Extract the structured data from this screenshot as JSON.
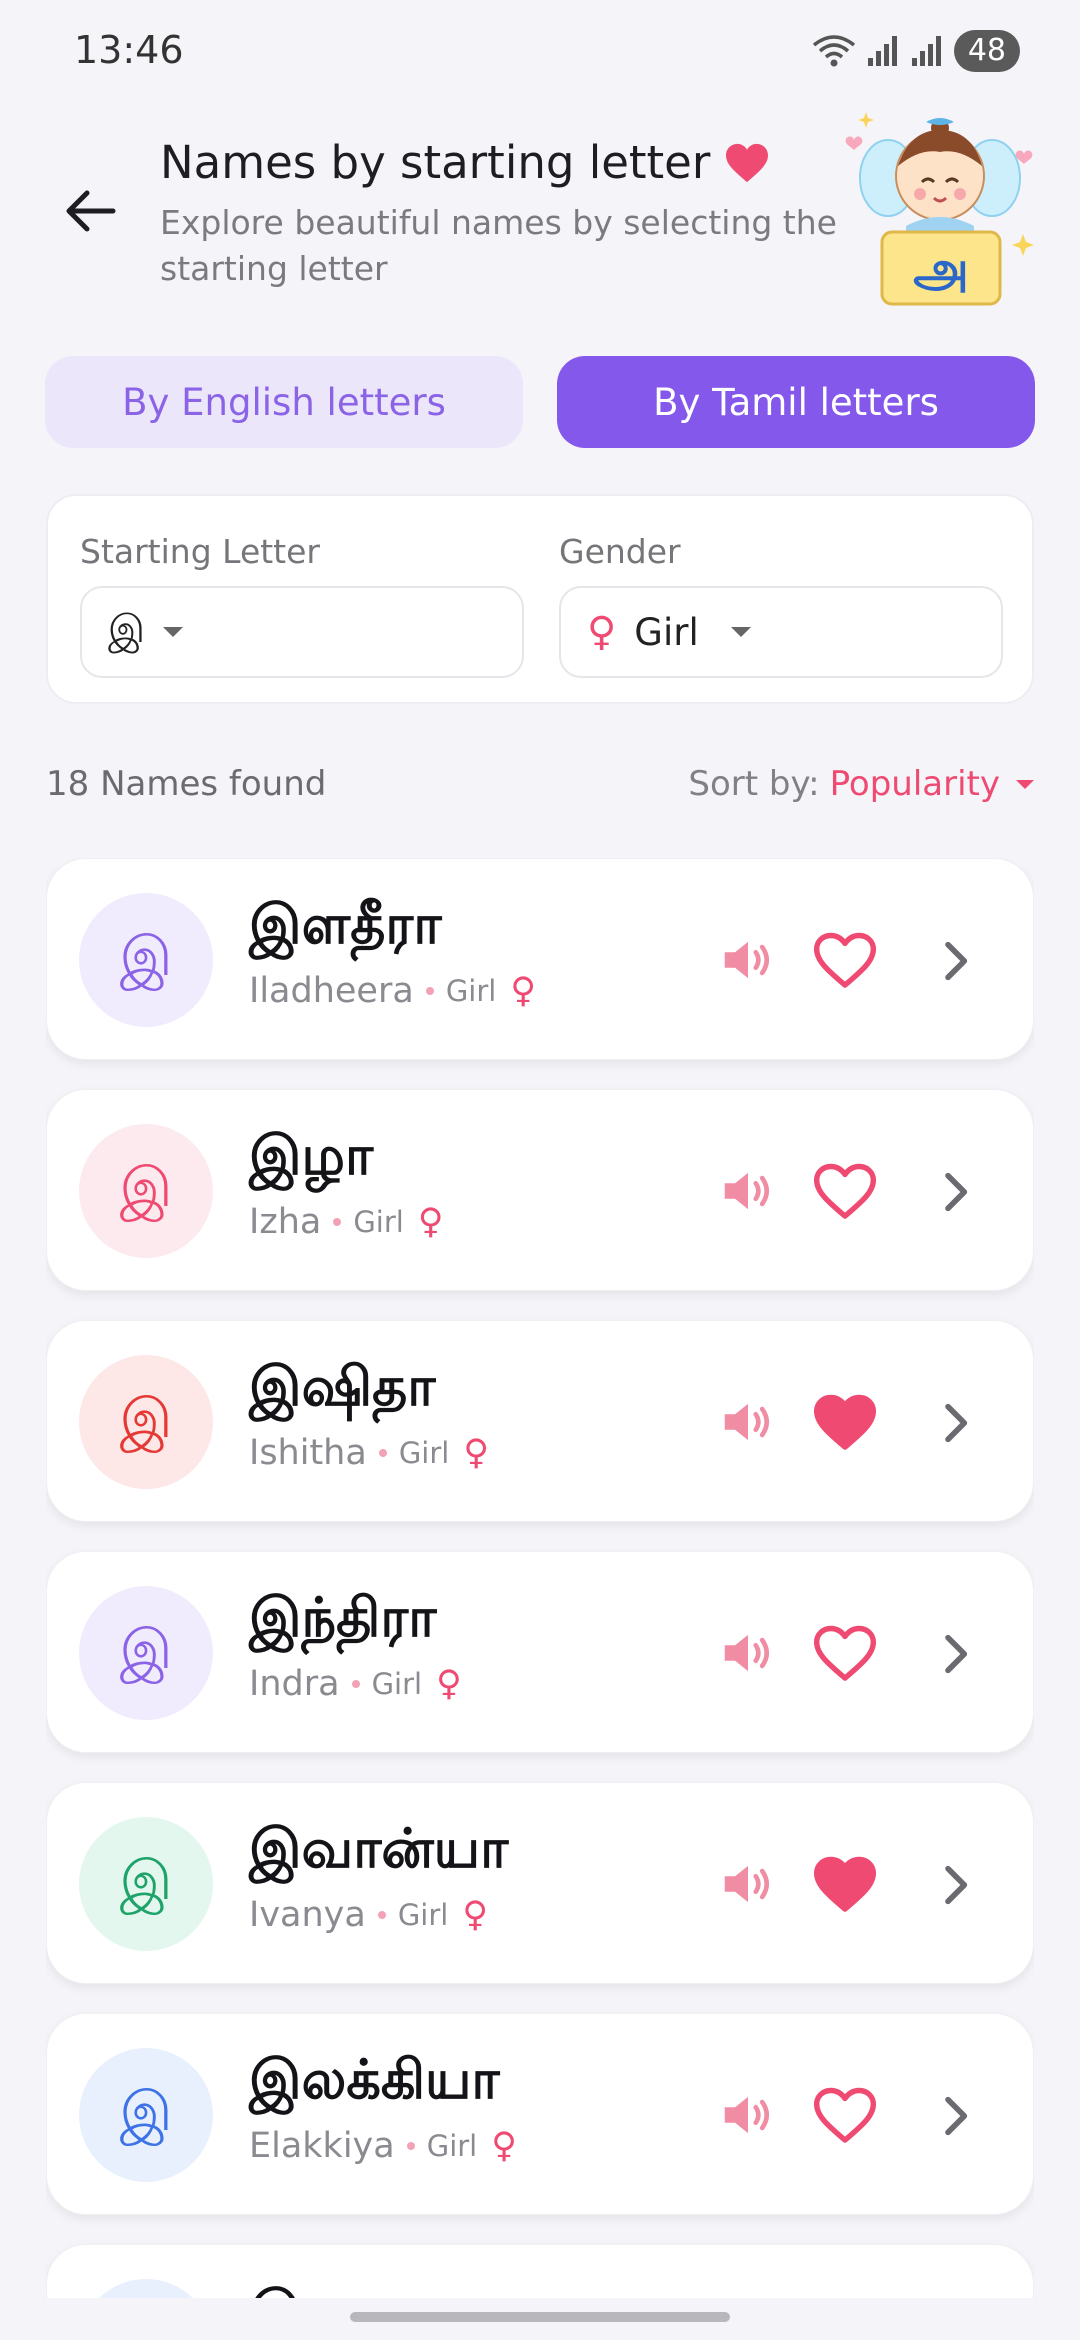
{
  "status": {
    "time": "13:46",
    "battery": "48"
  },
  "header": {
    "title": "Names by starting letter",
    "subtitle": "Explore beautiful names by selecting the starting letter",
    "mascot_letter": "அ"
  },
  "tabs": {
    "english": "By English letters",
    "tamil": "By Tamil letters",
    "active": "tamil"
  },
  "filters": {
    "letter_label": "Starting Letter",
    "letter_value": "இ",
    "gender_label": "Gender",
    "gender_value": "Girl",
    "gender_symbol": "♀"
  },
  "results": {
    "count_text": "18 Names found",
    "sort_label": "Sort by:",
    "sort_value": "Popularity"
  },
  "names": [
    {
      "tamil": "இளதீரா",
      "english": "Iladheera",
      "gender": "Girl",
      "avatar_letter": "இ",
      "avatar_bg": "#f1ecfd",
      "avatar_fg": "#8a63e6",
      "favorite": false
    },
    {
      "tamil": "இழா",
      "english": "Izha",
      "gender": "Girl",
      "avatar_letter": "இ",
      "avatar_bg": "#fdeaee",
      "avatar_fg": "#ef4a72",
      "favorite": false
    },
    {
      "tamil": "இஷிதா",
      "english": "Ishitha",
      "gender": "Girl",
      "avatar_letter": "இ",
      "avatar_bg": "#fde7e7",
      "avatar_fg": "#e53935",
      "favorite": true
    },
    {
      "tamil": "இந்திரா",
      "english": "Indra",
      "gender": "Girl",
      "avatar_letter": "இ",
      "avatar_bg": "#f1ecfd",
      "avatar_fg": "#8a63e6",
      "favorite": false
    },
    {
      "tamil": "இவான்யா",
      "english": "Ivanya",
      "gender": "Girl",
      "avatar_letter": "இ",
      "avatar_bg": "#e4f7ee",
      "avatar_fg": "#1ea36a",
      "favorite": true
    },
    {
      "tamil": "இலக்கியா",
      "english": "Elakkiya",
      "gender": "Girl",
      "avatar_letter": "இ",
      "avatar_bg": "#e8f0fd",
      "avatar_fg": "#3d73e6",
      "favorite": false
    },
    {
      "tamil": "இ",
      "english": "",
      "gender": "",
      "avatar_letter": "",
      "avatar_bg": "#e8f0fd",
      "avatar_fg": "#3d73e6",
      "favorite": false
    }
  ],
  "icons": {
    "back": "arrow-left-icon",
    "speaker": "speaker-icon",
    "heart": "heart-icon",
    "chevron": "chevron-right-icon"
  },
  "colors": {
    "accent": "#8558ec",
    "pink": "#ef4a72",
    "background": "#f5f5f9"
  }
}
